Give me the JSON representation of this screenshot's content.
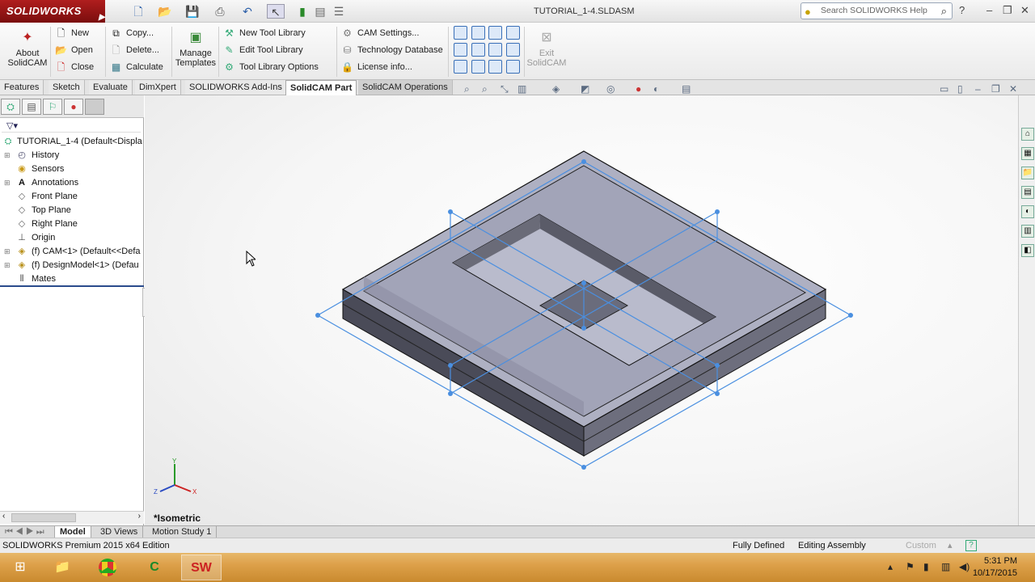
{
  "app": {
    "logo_text": "SOLIDWORKS",
    "document_title": "TUTORIAL_1-4.SLDASM"
  },
  "search": {
    "placeholder": "Search SOLIDWORKS Help"
  },
  "ribbon": {
    "about": "About SolidCAM",
    "new": "New",
    "open": "Open",
    "close": "Close",
    "copy": "Copy...",
    "delete": "Delete...",
    "calculate": "Calculate",
    "manage_templates": "Manage Templates",
    "new_tool_library": "New Tool Library",
    "edit_tool_library": "Edit Tool Library",
    "tool_library_options": "Tool Library Options",
    "cam_settings": "CAM Settings...",
    "technology_database": "Technology Database",
    "license_info": "License info...",
    "exit": "Exit SolidCAM"
  },
  "tabs": [
    "Features",
    "Sketch",
    "Evaluate",
    "DimXpert",
    "SOLIDWORKS Add-Ins",
    "SolidCAM Part",
    "SolidCAM Operations"
  ],
  "active_tab": "SolidCAM Part",
  "tree": {
    "root": "TUTORIAL_1-4  (Default<Displa",
    "items": [
      "History",
      "Sensors",
      "Annotations",
      "Front Plane",
      "Top Plane",
      "Right Plane",
      "Origin",
      "(f) CAM<1> (Default<<Defa",
      "(f) DesignModel<1> (Defau",
      "Mates"
    ]
  },
  "viewport": {
    "view_label": "*Isometric"
  },
  "bottom_tabs": [
    "Model",
    "3D Views",
    "Motion Study 1"
  ],
  "status": {
    "edition": "SOLIDWORKS Premium 2015 x64 Edition",
    "state": "Fully Defined",
    "mode": "Editing Assembly",
    "units": "Custom"
  },
  "clock": {
    "time": "5:31 PM",
    "date": "10/17/2015"
  },
  "colors": {
    "brand_red": "#9a1414",
    "sketch_blue": "#4a8fe0",
    "taskbar": "#dda04a"
  }
}
